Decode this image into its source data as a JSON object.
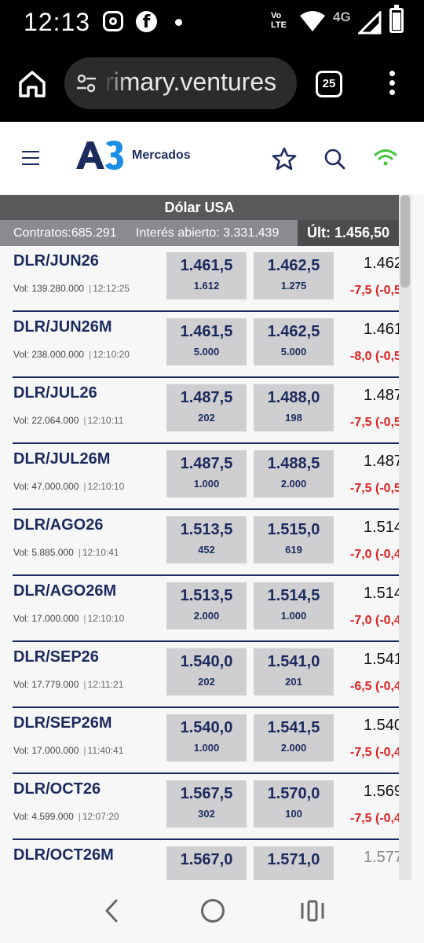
{
  "status_bar": {
    "time": "12:13",
    "network": "4G",
    "volte": "Vo LTE"
  },
  "browser": {
    "url": "rimary.ventures",
    "tab_count": "25"
  },
  "app": {
    "brand": "Mercados"
  },
  "title": "Dólar USA",
  "info": {
    "contracts": "Contratos:685.291",
    "interest": "Interés abierto: 3.331.439",
    "last": "Últ: 1.456,50"
  },
  "rows": [
    {
      "symbol": "DLR/JUN26",
      "vol_label": "Vol:",
      "vol": "139.280.000",
      "time": "12:12:25",
      "bid_price": "1.461,5",
      "bid_qty": "1.612",
      "ask_price": "1.462,5",
      "ask_qty": "1.275",
      "last": "1.462",
      "change": "-7,5 (-0,5"
    },
    {
      "symbol": "DLR/JUN26M",
      "vol_label": "Vol:",
      "vol": "238.000.000",
      "time": "12:10:20",
      "bid_price": "1.461,5",
      "bid_qty": "5.000",
      "ask_price": "1.462,5",
      "ask_qty": "5.000",
      "last": "1.461",
      "change": "-8,0 (-0,5"
    },
    {
      "symbol": "DLR/JUL26",
      "vol_label": "Vol:",
      "vol": "22.064.000",
      "time": "12:10:11",
      "bid_price": "1.487,5",
      "bid_qty": "202",
      "ask_price": "1.488,0",
      "ask_qty": "198",
      "last": "1.487",
      "change": "-7,5 (-0,5"
    },
    {
      "symbol": "DLR/JUL26M",
      "vol_label": "Vol:",
      "vol": "47.000.000",
      "time": "12:10:10",
      "bid_price": "1.487,5",
      "bid_qty": "1.000",
      "ask_price": "1.488,5",
      "ask_qty": "2.000",
      "last": "1.487",
      "change": "-7,5 (-0,5"
    },
    {
      "symbol": "DLR/AGO26",
      "vol_label": "Vol:",
      "vol": "5.885.000",
      "time": "12:10:41",
      "bid_price": "1.513,5",
      "bid_qty": "452",
      "ask_price": "1.515,0",
      "ask_qty": "619",
      "last": "1.514",
      "change": "-7,0 (-0,4"
    },
    {
      "symbol": "DLR/AGO26M",
      "vol_label": "Vol:",
      "vol": "17.000.000",
      "time": "12:10:10",
      "bid_price": "1.513,5",
      "bid_qty": "2.000",
      "ask_price": "1.514,5",
      "ask_qty": "1.000",
      "last": "1.514",
      "change": "-7,0 (-0,4"
    },
    {
      "symbol": "DLR/SEP26",
      "vol_label": "Vol:",
      "vol": "17.779.000",
      "time": "12:11:21",
      "bid_price": "1.540,0",
      "bid_qty": "202",
      "ask_price": "1.541,0",
      "ask_qty": "201",
      "last": "1.541",
      "change": "-6,5 (-0,4"
    },
    {
      "symbol": "DLR/SEP26M",
      "vol_label": "Vol:",
      "vol": "17.000.000",
      "time": "11:40:41",
      "bid_price": "1.540,0",
      "bid_qty": "1.000",
      "ask_price": "1.541,5",
      "ask_qty": "2.000",
      "last": "1.540",
      "change": "-7,5 (-0,4"
    },
    {
      "symbol": "DLR/OCT26",
      "vol_label": "Vol:",
      "vol": "4.599.000",
      "time": "12:07:20",
      "bid_price": "1.567,5",
      "bid_qty": "302",
      "ask_price": "1.570,0",
      "ask_qty": "100",
      "last": "1.569",
      "change": "-7,5 (-0,4"
    },
    {
      "symbol": "DLR/OCT26M",
      "vol_label": "",
      "vol": "",
      "time": "",
      "bid_price": "1.567,0",
      "bid_qty": "",
      "ask_price": "1.571,0",
      "ask_qty": "",
      "last": "1.577",
      "change": ""
    }
  ],
  "colors": {
    "brand": "#1b2b5e",
    "brand_accent": "#1a8fe3",
    "negative": "#e0201f",
    "online": "#3fc43a"
  }
}
